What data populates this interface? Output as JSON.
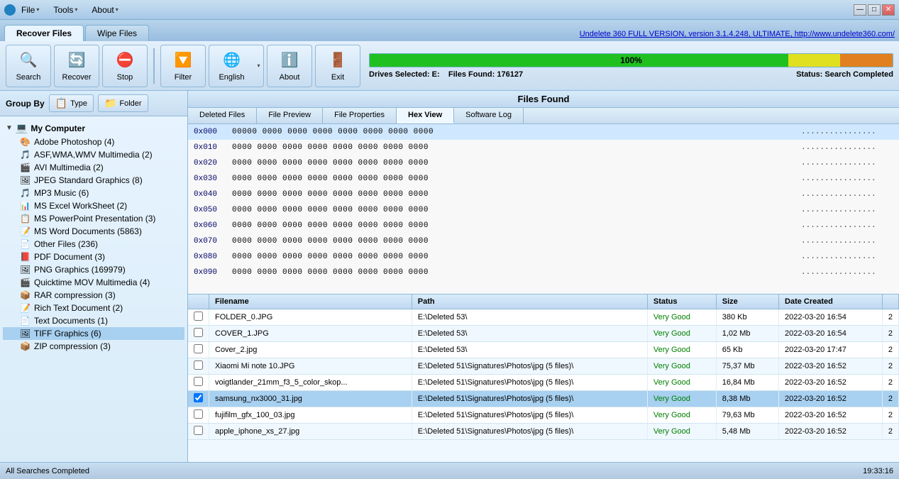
{
  "titlebar": {
    "menus": [
      {
        "label": "File",
        "has_arrow": true
      },
      {
        "label": "Tools",
        "has_arrow": true
      },
      {
        "label": "About",
        "has_arrow": true
      }
    ],
    "controls": [
      "—",
      "□",
      "✕"
    ]
  },
  "tabs": {
    "main": [
      {
        "label": "Recover Files",
        "active": true
      },
      {
        "label": "Wipe Files",
        "active": false
      }
    ],
    "version_link": "Undelete 360 FULL VERSION, version 3.1.4.248, ULTIMATE, http://www.undelete360.com/"
  },
  "toolbar": {
    "search_label": "Search",
    "recover_label": "Recover",
    "stop_label": "Stop",
    "filter_label": "Filter",
    "english_label": "English",
    "about_label": "About",
    "exit_label": "Exit"
  },
  "progress": {
    "percent": "100%",
    "drives_label": "Drives Selected:",
    "drives_value": "E:",
    "files_label": "Files Found:",
    "files_value": "176127",
    "status_label": "Status:",
    "status_value": "Search Completed"
  },
  "group_by": {
    "label": "Group By",
    "type_btn": "Type",
    "folder_btn": "Folder"
  },
  "files_found_header": "Files Found",
  "view_tabs": [
    {
      "label": "Deleted Files",
      "active": false
    },
    {
      "label": "File Preview",
      "active": false
    },
    {
      "label": "File Properties",
      "active": false
    },
    {
      "label": "Hex View",
      "active": true
    },
    {
      "label": "Software Log",
      "active": false
    }
  ],
  "hex_rows": [
    {
      "addr": "0x000",
      "bytes": "00000 0000 0000 0000 0000 0000 0000 0000",
      "ascii": "................"
    },
    {
      "addr": "0x010",
      "bytes": "0000 0000 0000 0000 0000 0000 0000 0000",
      "ascii": "................"
    },
    {
      "addr": "0x020",
      "bytes": "0000 0000 0000 0000 0000 0000 0000 0000",
      "ascii": "................"
    },
    {
      "addr": "0x030",
      "bytes": "0000 0000 0000 0000 0000 0000 0000 0000",
      "ascii": "................"
    },
    {
      "addr": "0x040",
      "bytes": "0000 0000 0000 0000 0000 0000 0000 0000",
      "ascii": "................"
    },
    {
      "addr": "0x050",
      "bytes": "0000 0000 0000 0000 0000 0000 0000 0000",
      "ascii": "................"
    },
    {
      "addr": "0x060",
      "bytes": "0000 0000 0000 0000 0000 0000 0000 0000",
      "ascii": "................"
    },
    {
      "addr": "0x070",
      "bytes": "0000 0000 0000 0000 0000 0000 0000 0000",
      "ascii": "................"
    },
    {
      "addr": "0x080",
      "bytes": "0000 0000 0000 0000 0000 0000 0000 0000",
      "ascii": "................"
    },
    {
      "addr": "0x090",
      "bytes": "0000 0000 0000 0000 0000 0000 0000 0000",
      "ascii": "................"
    }
  ],
  "file_table": {
    "columns": [
      "",
      "Filename",
      "Path",
      "Status",
      "Size",
      "Date Created",
      ""
    ],
    "rows": [
      {
        "checked": false,
        "filename": "FOLDER_0.JPG",
        "path": "E:\\Deleted 53\\",
        "status": "Very Good",
        "size": "380 Kb",
        "date": "2022-03-20 16:54",
        "extra": "2",
        "selected": false
      },
      {
        "checked": false,
        "filename": "COVER_1.JPG",
        "path": "E:\\Deleted 53\\",
        "status": "Very Good",
        "size": "1,02 Mb",
        "date": "2022-03-20 16:54",
        "extra": "2",
        "selected": false
      },
      {
        "checked": false,
        "filename": "Cover_2.jpg",
        "path": "E:\\Deleted 53\\",
        "status": "Very Good",
        "size": "65 Kb",
        "date": "2022-03-20 17:47",
        "extra": "2",
        "selected": false
      },
      {
        "checked": false,
        "filename": "Xiaomi Mi note 10.JPG",
        "path": "E:\\Deleted 51\\Signatures\\Photos\\jpg (5 files)\\",
        "status": "Very Good",
        "size": "75,37 Mb",
        "date": "2022-03-20 16:52",
        "extra": "2",
        "selected": false
      },
      {
        "checked": false,
        "filename": "voigtlander_21mm_f3_5_color_skop...",
        "path": "E:\\Deleted 51\\Signatures\\Photos\\jpg (5 files)\\",
        "status": "Very Good",
        "size": "16,84 Mb",
        "date": "2022-03-20 16:52",
        "extra": "2",
        "selected": false
      },
      {
        "checked": true,
        "filename": "samsung_nx3000_31.jpg",
        "path": "E:\\Deleted 51\\Signatures\\Photos\\jpg (5 files)\\",
        "status": "Very Good",
        "size": "8,38 Mb",
        "date": "2022-03-20 16:52",
        "extra": "2",
        "selected": true
      },
      {
        "checked": false,
        "filename": "fujifilm_gfx_100_03.jpg",
        "path": "E:\\Deleted 51\\Signatures\\Photos\\jpg (5 files)\\",
        "status": "Very Good",
        "size": "79,63 Mb",
        "date": "2022-03-20 16:52",
        "extra": "2",
        "selected": false
      },
      {
        "checked": false,
        "filename": "apple_iphone_xs_27.jpg",
        "path": "E:\\Deleted 51\\Signatures\\Photos\\jpg (5 files)\\",
        "status": "Very Good",
        "size": "5,48 Mb",
        "date": "2022-03-20 16:52",
        "extra": "2",
        "selected": false
      }
    ]
  },
  "sidebar": {
    "root_label": "My Computer",
    "items": [
      {
        "label": "Adobe Photoshop (4)",
        "icon": "🎨"
      },
      {
        "label": "ASF,WMA,WMV Multimedia (2)",
        "icon": "🎵"
      },
      {
        "label": "AVI Multimedia (2)",
        "icon": "🎬"
      },
      {
        "label": "JPEG Standard Graphics (8)",
        "icon": "🖼"
      },
      {
        "label": "MP3 Music (6)",
        "icon": "🎵"
      },
      {
        "label": "MS Excel WorkSheet (2)",
        "icon": "📊"
      },
      {
        "label": "MS PowerPoint Presentation (3)",
        "icon": "📋"
      },
      {
        "label": "MS Word Documents (5863)",
        "icon": "📝"
      },
      {
        "label": "Other Files (236)",
        "icon": "📄"
      },
      {
        "label": "PDF Document (3)",
        "icon": "📕"
      },
      {
        "label": "PNG Graphics (169979)",
        "icon": "🖼"
      },
      {
        "label": "Quicktime MOV Multimedia (4)",
        "icon": "🎬"
      },
      {
        "label": "RAR compression (3)",
        "icon": "📦"
      },
      {
        "label": "Rich Text Document (2)",
        "icon": "📝"
      },
      {
        "label": "Text Documents (1)",
        "icon": "📄"
      },
      {
        "label": "TIFF Graphics (6)",
        "icon": "🖼",
        "selected": true
      },
      {
        "label": "ZIP compression (3)",
        "icon": "📦"
      }
    ]
  },
  "statusbar": {
    "left": "All Searches Completed",
    "right": "19:33:16"
  }
}
